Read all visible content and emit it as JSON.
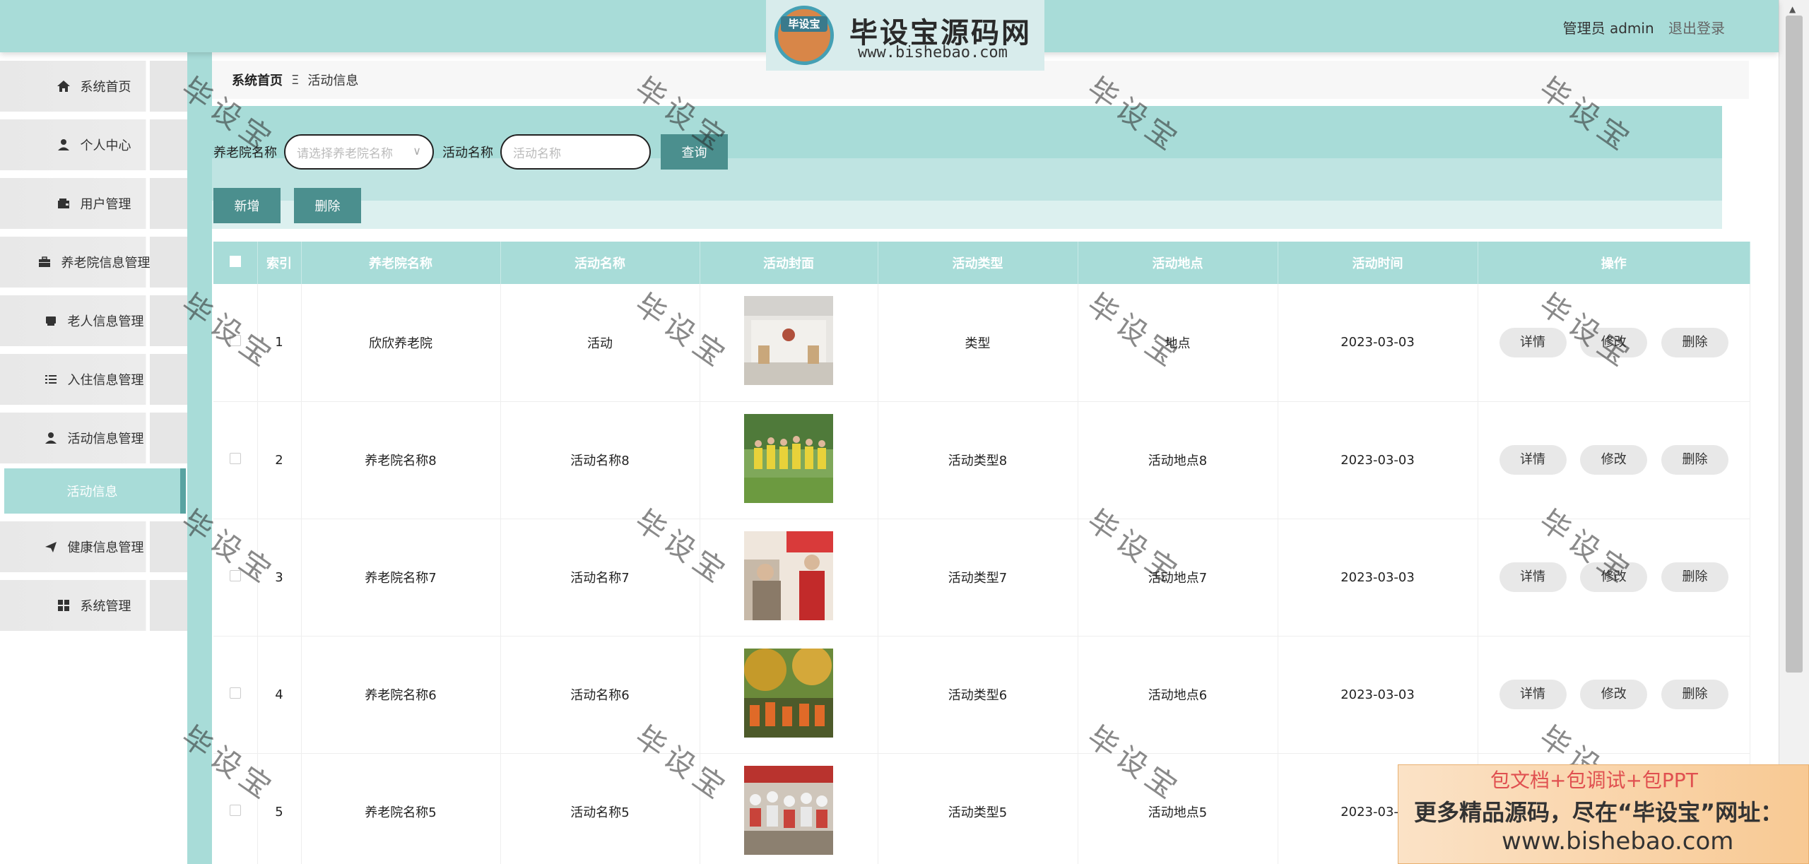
{
  "header": {
    "logo_badge": "毕设宝",
    "logo_title": "毕设宝源码网",
    "logo_url": "www.bishebao.com",
    "user_label": "管理员 admin",
    "logout": "退出登录"
  },
  "sidebar": {
    "items": [
      {
        "label": "系统首页",
        "icon": "home-icon"
      },
      {
        "label": "个人中心",
        "icon": "person-icon"
      },
      {
        "label": "用户管理",
        "icon": "wallet-icon"
      },
      {
        "label": "养老院信息管理",
        "icon": "briefcase-icon"
      },
      {
        "label": "老人信息管理",
        "icon": "box-icon"
      },
      {
        "label": "入住信息管理",
        "icon": "list-icon"
      },
      {
        "label": "活动信息管理",
        "icon": "user-icon"
      },
      {
        "label": "健康信息管理",
        "icon": "send-icon"
      },
      {
        "label": "系统管理",
        "icon": "grid-icon"
      }
    ],
    "active_sub": "活动信息"
  },
  "breadcrumb": {
    "home": "系统首页",
    "sep": "Ξ",
    "current": "活动信息"
  },
  "filter": {
    "label1": "养老院名称",
    "select_placeholder": "请选择养老院名称",
    "label2": "活动名称",
    "input_placeholder": "活动名称",
    "query": "查询"
  },
  "actions": {
    "add": "新增",
    "delete": "删除"
  },
  "table": {
    "headers": [
      "索引",
      "养老院名称",
      "活动名称",
      "活动封面",
      "活动类型",
      "活动地点",
      "活动时间",
      "操作"
    ],
    "btn_detail": "详情",
    "btn_edit": "修改",
    "btn_delete": "删除",
    "rows": [
      {
        "index": "1",
        "home": "欣欣养老院",
        "name": "活动",
        "type": "类型",
        "place": "地点",
        "time": "2023-03-03"
      },
      {
        "index": "2",
        "home": "养老院名称8",
        "name": "活动名称8",
        "type": "活动类型8",
        "place": "活动地点8",
        "time": "2023-03-03"
      },
      {
        "index": "3",
        "home": "养老院名称7",
        "name": "活动名称7",
        "type": "活动类型7",
        "place": "活动地点7",
        "time": "2023-03-03"
      },
      {
        "index": "4",
        "home": "养老院名称6",
        "name": "活动名称6",
        "type": "活动类型6",
        "place": "活动地点6",
        "time": "2023-03-03"
      },
      {
        "index": "5",
        "home": "养老院名称5",
        "name": "活动名称5",
        "type": "活动类型5",
        "place": "活动地点5",
        "time": "2023-03-03"
      }
    ]
  },
  "watermark": "毕设宝",
  "ad": {
    "line1": "包文档+包调试+包PPT",
    "line2": "更多精品源码，尽在“毕设宝”网址：",
    "line3": "www.bishebao.com"
  },
  "colors": {
    "theme": "#a8dcd8",
    "button": "#4b8f8e"
  }
}
